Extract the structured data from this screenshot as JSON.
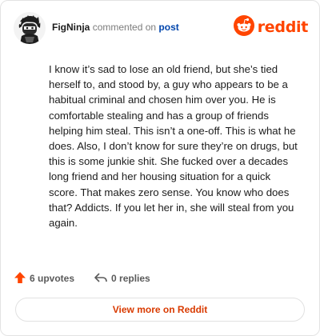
{
  "header": {
    "username": "FigNinja",
    "action_text": "commented on",
    "post_link": "post",
    "logo_text": "reddit"
  },
  "comment": {
    "body": "I know it’s sad to lose an old friend, but she’s tied herself to, and stood by, a guy who appears to be a habitual criminal and chosen him over you. He is comfortable stealing and has a group of friends helping him steal. This isn’t a one-off. This is what he does. Also, I don’t know for sure they’re on drugs, but this is some junkie shit. She fucked over a decades long friend and her housing situation for a quick score. That makes zero sense. You know who does that? Addicts. If you let her in, she will steal from you again."
  },
  "actions": {
    "upvotes": "6 upvotes",
    "replies": "0 replies"
  },
  "footer": {
    "view_more": "View more on Reddit"
  },
  "colors": {
    "brand": "#ff4500",
    "link": "#0045ac",
    "view_more_text": "#d93a00"
  },
  "icons": [
    "avatar",
    "reddit-logo-icon",
    "upvote-arrow-icon",
    "reply-icon"
  ]
}
